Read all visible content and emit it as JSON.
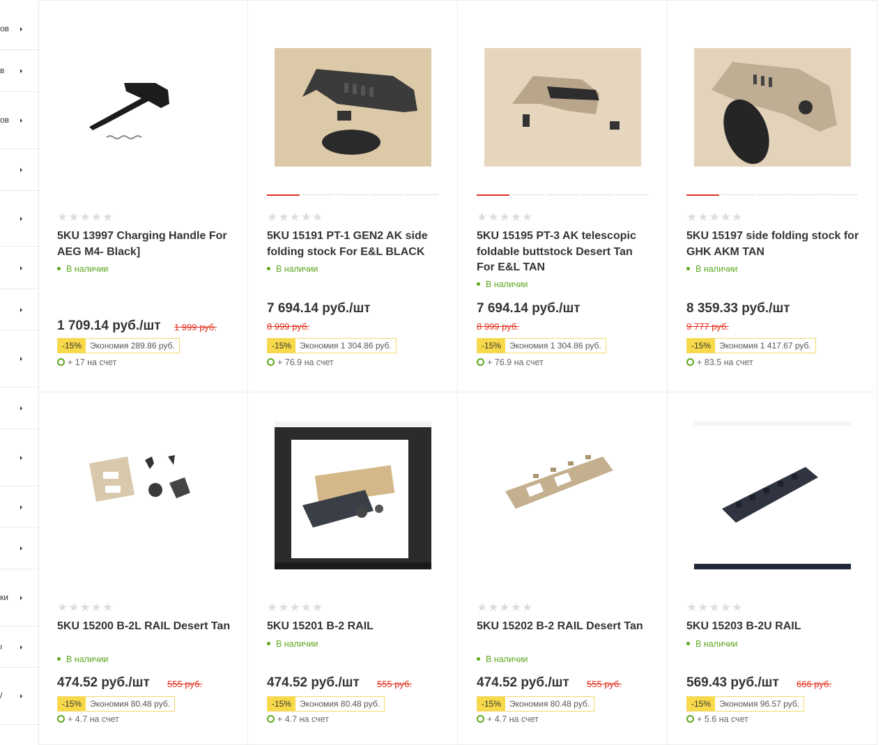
{
  "sidebar": {
    "items": [
      {
        "label": "ов"
      },
      {
        "label": "в"
      },
      {
        "label": "ов"
      },
      {
        "label": ""
      },
      {
        "label": ""
      },
      {
        "label": ""
      },
      {
        "label": ""
      },
      {
        "label": ""
      },
      {
        "label": ""
      },
      {
        "label": ""
      },
      {
        "label": ""
      },
      {
        "label": ""
      },
      {
        "label": "ки"
      },
      {
        "label": "ı"
      },
      {
        "label": "/"
      }
    ]
  },
  "products": [
    {
      "name": "5KU 13997 Charging Handle For AEG M4- Black]",
      "stock": "В наличии",
      "price": "1 709.14 руб./шт",
      "old_price": "1 999 руб.",
      "discount": "-15%",
      "savings": "Экономия 289.86 руб.",
      "bonus": "+ 17 на счет",
      "rating_stars": "★★★★★",
      "rating": 0,
      "image": "charging-handle",
      "dots_visible": false
    },
    {
      "name": "5KU 15191 PT-1 GEN2 AK side folding stock For E&L BLACK",
      "stock": "В наличии",
      "price": "7 694.14 руб./шт",
      "old_price": "8 999 руб.",
      "discount": "-15%",
      "savings": "Экономия 1 304.86 руб.",
      "bonus": "+ 76.9 на счет",
      "rating_stars": "★★★★★",
      "rating": 0,
      "image": "stock-black",
      "dots_visible": true
    },
    {
      "name": "5KU 15195 PT-3 AK telescopic foldable buttstock Desert Tan For E&L TAN",
      "stock": "В наличии",
      "price": "7 694.14 руб./шт",
      "old_price": "8 999 руб.",
      "discount": "-15%",
      "savings": "Экономия 1 304.86 руб.",
      "bonus": "+ 76.9 на счет",
      "rating_stars": "★★★★★",
      "rating": 0,
      "image": "stock-tan",
      "dots_visible": true
    },
    {
      "name": "5KU 15197 side folding stock for GHK AKM TAN",
      "stock": "В наличии",
      "price": "8 359.33 руб./шт",
      "old_price": "9 777 руб.",
      "discount": "-15%",
      "savings": "Экономия 1 417.67 руб.",
      "bonus": "+ 83.5 на счет",
      "rating_stars": "★★★★★",
      "rating": 0,
      "image": "stock-tan-2",
      "dots_visible": true
    },
    {
      "name": "5KU 15200 B-2L RAIL Desert Tan",
      "stock": "В наличии",
      "price": "474.52 руб./шт",
      "old_price": "555 руб.",
      "discount": "-15%",
      "savings": "Экономия 80.48 руб.",
      "bonus": "+ 4.7 на счет",
      "rating_stars": "★★★★★",
      "rating": 0,
      "image": "rail-tan-parts",
      "dots_visible": false
    },
    {
      "name": "5KU 15201 B-2 RAIL",
      "stock": "В наличии",
      "price": "474.52 руб./шт",
      "old_price": "555 руб.",
      "discount": "-15%",
      "savings": "Экономия 80.48 руб.",
      "bonus": "+ 4.7 на счет",
      "rating_stars": "★★★★★",
      "rating": 0,
      "image": "rail-screenshot",
      "dots_visible": false
    },
    {
      "name": "5KU 15202 B-2 RAIL Desert Tan",
      "stock": "В наличии",
      "price": "474.52 руб./шт",
      "old_price": "555 руб.",
      "discount": "-15%",
      "savings": "Экономия 80.48 руб.",
      "bonus": "+ 4.7 на счет",
      "rating_stars": "★★★★★",
      "rating": 0,
      "image": "rail-tan",
      "dots_visible": false
    },
    {
      "name": "5KU 15203 B-2U RAIL",
      "stock": "В наличии",
      "price": "569.43 руб./шт",
      "old_price": "666 руб.",
      "discount": "-15%",
      "savings": "Экономия 96.57 руб.",
      "bonus": "+ 5.6 на счет",
      "rating_stars": "★★★★★",
      "rating": 0,
      "image": "rail-black",
      "dots_visible": false
    }
  ]
}
